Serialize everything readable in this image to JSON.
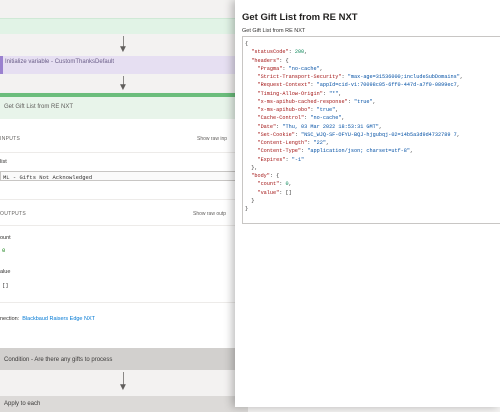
{
  "flow": {
    "variable_card_label": "Initialize variable - CustomThanksDefault",
    "action_card": {
      "title": "Get Gift List from RE NXT",
      "inputs_title": "INPUTS",
      "show_raw_inputs": "Show raw inp",
      "list_label": "list",
      "list_value": "ML - Gifts Not Acknowledged",
      "outputs_title": "OUTPUTS",
      "show_raw_outputs": "Show raw outp",
      "count_label": "ount",
      "count_value": "0",
      "value_label": "alue",
      "value_value": "[]",
      "connection_label": "nection:",
      "connection_link": "Blackbaud Raisers Edge NXT"
    },
    "condition_label": "Condition - Are there any gifts to process",
    "apply_label": "Apply to each"
  },
  "panel": {
    "title": "Get Gift List from RE NXT",
    "subtitle": "Get Gift List from RE NXT",
    "json": {
      "status_key": "\"statusCode\"",
      "status_val": "200",
      "headers_key": "\"headers\"",
      "headers": [
        {
          "key": "\"Pragma\"",
          "val": "\"no-cache\""
        },
        {
          "key": "\"Strict-Transport-Security\"",
          "val": "\"max-age=31536000;includeSubDomains\""
        },
        {
          "key": "\"Request-Context\"",
          "val": "\"appId=cid-v1:70098c05-6ff0-447d-a7f0-0899ec7"
        },
        {
          "key": "\"Timing-Allow-Origin\"",
          "val": "\"*\""
        },
        {
          "key": "\"x-ms-apihub-cached-response\"",
          "val": "\"true\""
        },
        {
          "key": "\"x-ms-apihub-obo\"",
          "val": "\"true\""
        },
        {
          "key": "\"Cache-Control\"",
          "val": "\"no-cache\""
        },
        {
          "key": "\"Date\"",
          "val": "\"Thu, 03 Mar 2022 18:53:31 GMT\""
        },
        {
          "key": "\"Set-Cookie\"",
          "val": "\"NSC_WJQ-SF-OFYU-BQJ-hjgubqj-02=14b5a3d9d4732789 7"
        },
        {
          "key": "\"Content-Length\"",
          "val": "\"22\""
        },
        {
          "key": "\"Content-Type\"",
          "val": "\"application/json; charset=utf-8\""
        },
        {
          "key": "\"Expires\"",
          "val": "\"-1\""
        }
      ],
      "body_key": "\"body\"",
      "count_key": "\"count\"",
      "count_val": "0",
      "value_key": "\"value\"",
      "value_val": "[]"
    }
  },
  "colors": {
    "accent_green": "#6bbd7c",
    "variable_purple": "#9a81cf",
    "link_blue": "#0078d4"
  }
}
